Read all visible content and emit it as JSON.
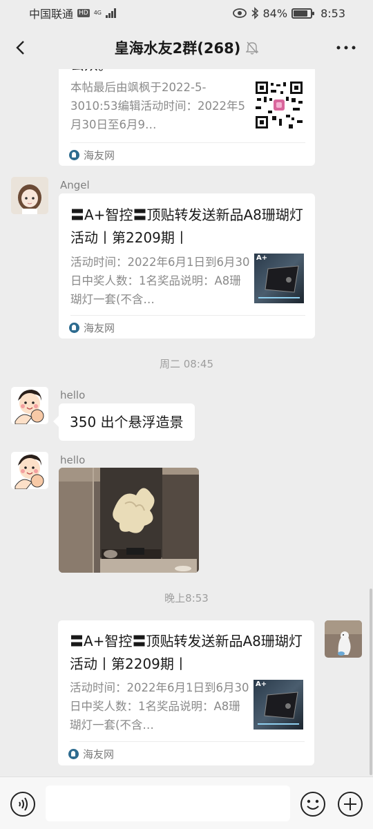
{
  "status_bar": {
    "carrier": "中国联通",
    "network_badge": "HD",
    "network_type": "4G",
    "battery": "84%",
    "battery_level": 0.84,
    "time": "8:53"
  },
  "header": {
    "title": "皇海水友2群(268)",
    "back_icon": "chevron-left-icon",
    "muted_icon": "bell-off-icon",
    "more_icon": "more-dots-icon"
  },
  "messages": {
    "card_top": {
      "title_fragment": "公众。",
      "desc": "本帖最后由飒枫于2022-5-3010:53编辑活动时间：2022年5月30日至6月9…",
      "source": "海友网",
      "thumb_icon": "qr-code-icon"
    },
    "angel": {
      "nickname": "Angel",
      "card": {
        "title": "〓A+智控〓顶贴转发送新品A8珊瑚灯活动丨第2209期丨",
        "desc": "活动时间：2022年6月1日到6月30日中奖人数：1名奖品说明：A8珊瑚灯一套(不含…",
        "source": "海友网",
        "thumb_label": "A+"
      }
    },
    "time_1": "周二 08:45",
    "hello_1": {
      "nickname": "hello",
      "text": "350 出个悬浮造景"
    },
    "hello_2": {
      "nickname": "hello",
      "image_icon": "aquarium-photo"
    },
    "time_2": "晚上8:53",
    "self": {
      "card": {
        "title": "〓A+智控〓顶贴转发送新品A8珊瑚灯活动丨第2209期丨",
        "desc": "活动时间：2022年6月1日到6月30日中奖人数：1名奖品说明：A8珊瑚灯一套(不含…",
        "source": "海友网",
        "thumb_label": "A+"
      }
    }
  },
  "input_bar": {
    "voice_icon": "voice-icon",
    "emoji_icon": "emoji-icon",
    "plus_icon": "plus-icon",
    "placeholder": ""
  },
  "colors": {
    "background": "#ededed",
    "bubble": "#ffffff",
    "meta_text": "#8a8a8a",
    "source_icon": "#2d6b8f"
  }
}
